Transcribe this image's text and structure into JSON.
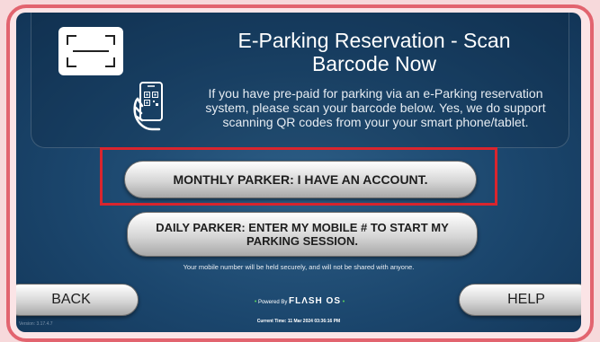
{
  "header": {
    "title": "E-Parking Reservation - Scan Barcode Now",
    "description": "If you have pre-paid for parking via an e-Parking reservation system, please scan your barcode below. Yes, we do support scanning QR codes from your your smart phone/tablet.",
    "scan_icon": "barcode-scanner-icon",
    "phone_icon": "phone-qr-code-icon"
  },
  "options": {
    "monthly_label": "MONTHLY PARKER: I HAVE AN ACCOUNT.",
    "daily_label": "DAILY PARKER: ENTER MY MOBILE # TO START MY PARKING SESSION."
  },
  "privacy_note": "Your mobile number will be held securely, and will not be shared with anyone.",
  "footer": {
    "back_label": "BACK",
    "help_label": "HELP",
    "powered_by": "Powered By",
    "brand": "FLΛSH OS",
    "current_time": "Current Time: 11 Mar 2024 03:36:16 PM",
    "version": "Version: 3.17.4.7"
  },
  "colors": {
    "highlight": "#d9252e",
    "frame": "#e2646f",
    "background": "#1b466d"
  }
}
